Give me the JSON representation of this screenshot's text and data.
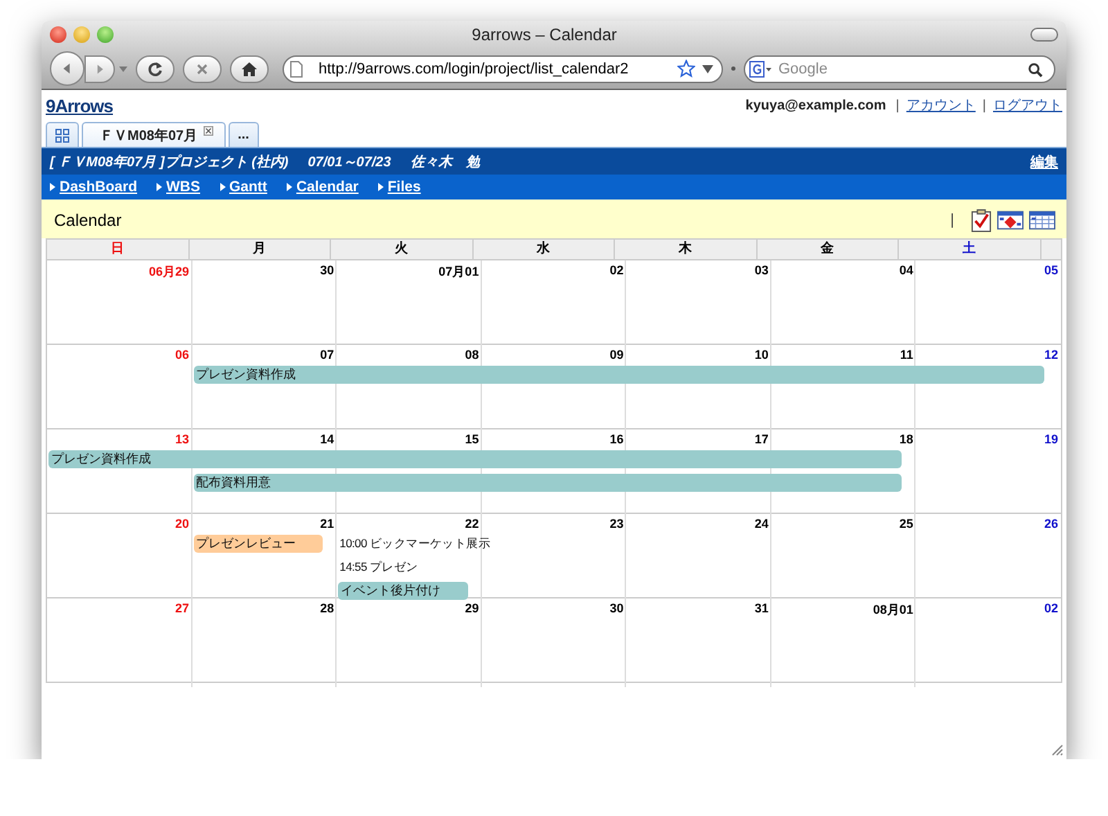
{
  "window": {
    "title": "9arrows – Calendar"
  },
  "toolbar": {
    "url": "http://9arrows.com/login/project/list_calendar2",
    "search_placeholder": "Google"
  },
  "site": {
    "logo": "9Arrows",
    "user": "kyuya@example.com",
    "links": [
      {
        "separator": "|",
        "label": "アカウント"
      },
      {
        "separator": "|",
        "label": "ログアウト"
      }
    ]
  },
  "tabs": [
    {
      "kind": "grid",
      "selected": false
    },
    {
      "kind": "label",
      "label": "ＦＶM08年07月",
      "selected": true
    },
    {
      "kind": "label",
      "label": "...",
      "selected": false
    }
  ],
  "project": {
    "title": "[ ＦＶM08年07月 ]プロジェクト (社内)",
    "period": "07/01～07/23",
    "owner": "佐々木　勉",
    "edit": "編集"
  },
  "nav": [
    "DashBoard",
    "WBS",
    "Gantt",
    "Calendar",
    "Files"
  ],
  "calendar": {
    "title": "Calendar",
    "separator": "|",
    "weekdays": [
      {
        "label": "日",
        "color": "#ee1111"
      },
      {
        "label": "月",
        "color": "#000000"
      },
      {
        "label": "火",
        "color": "#000000"
      },
      {
        "label": "水",
        "color": "#000000"
      },
      {
        "label": "木",
        "color": "#000000"
      },
      {
        "label": "金",
        "color": "#000000"
      },
      {
        "label": "土",
        "color": "#1111cc"
      }
    ],
    "weeks": [
      {
        "days": [
          "06月29",
          "30",
          "07月01",
          "02",
          "03",
          "04",
          "05"
        ]
      },
      {
        "days": [
          "06",
          "07",
          "08",
          "09",
          "10",
          "11",
          "12"
        ],
        "lanes": [
          [
            {
              "kind": "empty"
            },
            {
              "kind": "bar",
              "label": "プレゼン資料作成",
              "color": "#99cccc"
            },
            {
              "kind": "continue"
            },
            {
              "kind": "continue"
            },
            {
              "kind": "continue"
            },
            {
              "kind": "continue"
            },
            {
              "kind": "continue"
            }
          ]
        ]
      },
      {
        "days": [
          "13",
          "14",
          "15",
          "16",
          "17",
          "18",
          "19"
        ],
        "lanes": [
          [
            {
              "kind": "bar",
              "label": "プレゼン資料作成",
              "color": "#99cccc"
            },
            {
              "kind": "continue"
            },
            {
              "kind": "continue"
            },
            {
              "kind": "continue"
            },
            {
              "kind": "continue"
            },
            {
              "kind": "continue"
            },
            {
              "kind": "empty"
            }
          ],
          [
            {
              "kind": "empty"
            },
            {
              "kind": "bar",
              "label": "配布資料用意",
              "color": "#99cccc"
            },
            {
              "kind": "continue"
            },
            {
              "kind": "continue"
            },
            {
              "kind": "continue"
            },
            {
              "kind": "continue"
            },
            {
              "kind": "empty"
            }
          ]
        ]
      },
      {
        "days": [
          "20",
          "21",
          "22",
          "23",
          "24",
          "25",
          "26"
        ],
        "lanes": [
          [
            {
              "kind": "empty"
            },
            {
              "kind": "bar",
              "label": "プレゼンレビュー",
              "color": "#ffcc99"
            },
            {
              "kind": "timed",
              "label": "10:00 ビックマーケット展示"
            },
            {
              "kind": "empty"
            },
            {
              "kind": "empty"
            },
            {
              "kind": "empty"
            },
            {
              "kind": "empty"
            }
          ],
          [
            {
              "kind": "empty"
            },
            {
              "kind": "empty"
            },
            {
              "kind": "timed",
              "label": "14:55 プレゼン"
            },
            {
              "kind": "empty"
            },
            {
              "kind": "empty"
            },
            {
              "kind": "empty"
            },
            {
              "kind": "empty"
            }
          ],
          [
            {
              "kind": "empty"
            },
            {
              "kind": "empty"
            },
            {
              "kind": "bar",
              "label": "イベント後片付け",
              "color": "#99cccc"
            },
            {
              "kind": "empty"
            },
            {
              "kind": "empty"
            },
            {
              "kind": "empty"
            },
            {
              "kind": "empty"
            }
          ]
        ]
      },
      {
        "days": [
          "27",
          "28",
          "29",
          "30",
          "31",
          "08月01",
          "02"
        ]
      }
    ]
  }
}
